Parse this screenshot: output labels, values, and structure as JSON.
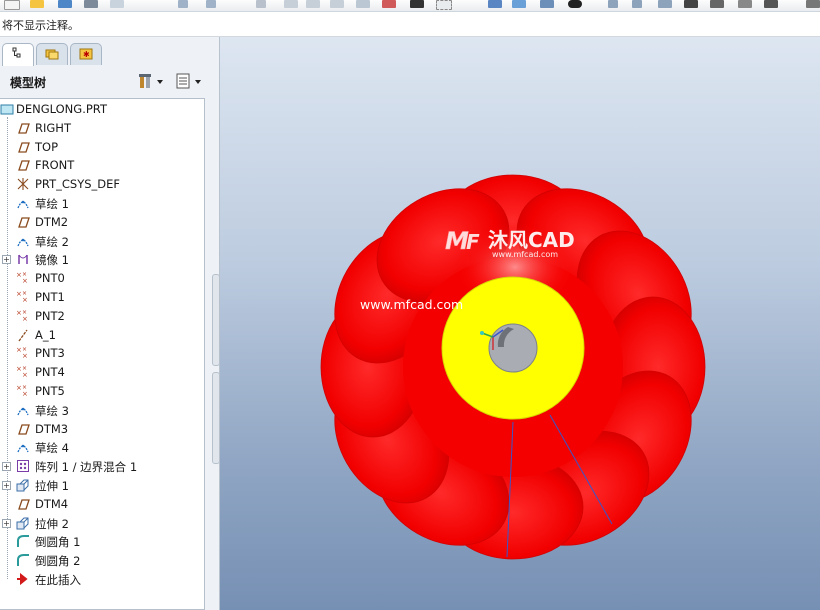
{
  "message_line": "将不显示注释。",
  "panel": {
    "tree_title": "模型树",
    "tabs": [
      {
        "name": "model-tree-tab",
        "icon": "model-tree-icon",
        "active": true
      },
      {
        "name": "folder-browser-tab",
        "icon": "folder-icon",
        "active": false
      },
      {
        "name": "favorites-tab",
        "icon": "favorites-icon",
        "active": false
      }
    ],
    "header_buttons": [
      {
        "name": "tree-settings-button",
        "icon": "tools-icon"
      },
      {
        "name": "tree-show-button",
        "icon": "list-icon"
      }
    ]
  },
  "tree": [
    {
      "label": "DENGLONG.PRT",
      "icon": "part-icon",
      "level": 0,
      "expander": false
    },
    {
      "label": "RIGHT",
      "icon": "datum-plane-icon",
      "level": 1,
      "expander": false
    },
    {
      "label": "TOP",
      "icon": "datum-plane-icon",
      "level": 1,
      "expander": false
    },
    {
      "label": "FRONT",
      "icon": "datum-plane-icon",
      "level": 1,
      "expander": false
    },
    {
      "label": "PRT_CSYS_DEF",
      "icon": "csys-icon",
      "level": 1,
      "expander": false
    },
    {
      "label": "草绘 1",
      "icon": "sketch-icon",
      "level": 1,
      "expander": false
    },
    {
      "label": "DTM2",
      "icon": "datum-plane-icon",
      "level": 1,
      "expander": false
    },
    {
      "label": "草绘 2",
      "icon": "sketch-icon",
      "level": 1,
      "expander": false
    },
    {
      "label": "镜像 1",
      "icon": "mirror-icon",
      "level": 1,
      "expander": true
    },
    {
      "label": "PNT0",
      "icon": "datum-point-icon",
      "level": 1,
      "expander": false
    },
    {
      "label": "PNT1",
      "icon": "datum-point-icon",
      "level": 1,
      "expander": false
    },
    {
      "label": "PNT2",
      "icon": "datum-point-icon",
      "level": 1,
      "expander": false
    },
    {
      "label": "A_1",
      "icon": "datum-axis-icon",
      "level": 1,
      "expander": false
    },
    {
      "label": "PNT3",
      "icon": "datum-point-icon",
      "level": 1,
      "expander": false
    },
    {
      "label": "PNT4",
      "icon": "datum-point-icon",
      "level": 1,
      "expander": false
    },
    {
      "label": "PNT5",
      "icon": "datum-point-icon",
      "level": 1,
      "expander": false
    },
    {
      "label": "草绘 3",
      "icon": "sketch-icon",
      "level": 1,
      "expander": false
    },
    {
      "label": "DTM3",
      "icon": "datum-plane-icon",
      "level": 1,
      "expander": false
    },
    {
      "label": "草绘 4",
      "icon": "sketch-icon",
      "level": 1,
      "expander": false
    },
    {
      "label": "阵列 1 / 边界混合 1",
      "icon": "pattern-icon",
      "level": 1,
      "expander": true
    },
    {
      "label": "拉伸 1",
      "icon": "extrude-icon",
      "level": 1,
      "expander": true
    },
    {
      "label": "DTM4",
      "icon": "datum-plane-icon",
      "level": 1,
      "expander": false
    },
    {
      "label": "拉伸 2",
      "icon": "extrude-icon",
      "level": 1,
      "expander": true
    },
    {
      "label": "倒圆角 1",
      "icon": "round-icon",
      "level": 1,
      "expander": false
    },
    {
      "label": "倒圆角 2",
      "icon": "round-icon",
      "level": 1,
      "expander": false
    },
    {
      "label": "在此插入",
      "icon": "insert-here-arrow-icon",
      "level": 1,
      "expander": false
    }
  ],
  "watermark": {
    "brand": "沐风CAD",
    "url_small": "www.mfcad.com",
    "url_large": "www.mfcad.com"
  },
  "colors": {
    "lantern_red": "#f40000",
    "cap_yellow": "#ffff00",
    "hole_gray": "#a9adb3",
    "bg_top": "#dde6f1",
    "bg_bottom": "#7690b4"
  }
}
